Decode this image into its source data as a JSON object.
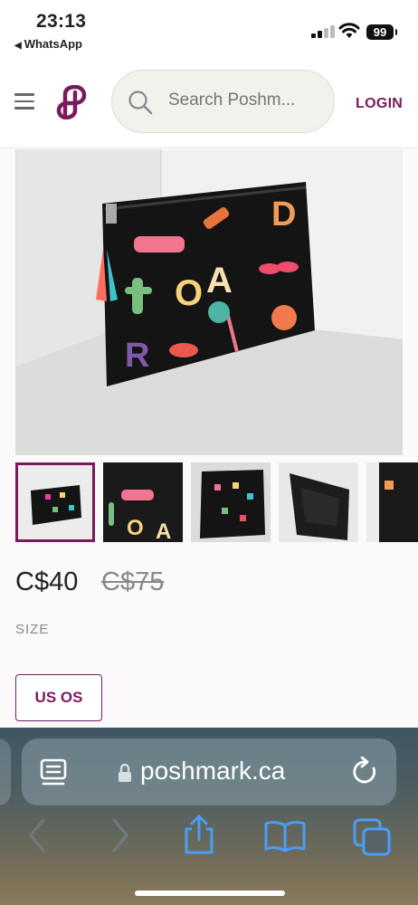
{
  "status_bar": {
    "time": "23:13",
    "back_app": "WhatsApp",
    "battery": "99"
  },
  "header": {
    "menu_icon": "hamburger-icon",
    "logo": "poshmark-logo",
    "search_placeholder": "Search Poshm...",
    "login_label": "LOGIN",
    "accent_color": "#7a1a5c"
  },
  "listing": {
    "image_count_visible": 5,
    "price": "C$40",
    "original_price": "C$75",
    "size_label": "SIZE",
    "size_value": "US OS"
  },
  "browser": {
    "url": "poshmark.ca",
    "icons": [
      "reader-icon",
      "lock-icon",
      "reload-icon",
      "back-icon",
      "forward-icon",
      "share-icon",
      "bookmarks-icon",
      "tabs-icon"
    ]
  }
}
